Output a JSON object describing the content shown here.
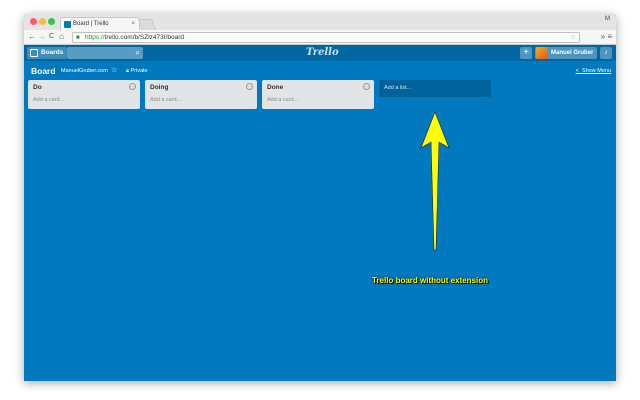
{
  "browser": {
    "tab_title": "Board | Trello",
    "tab_close": "×",
    "profile_initial": "M",
    "url_https": "https://",
    "url_rest": "trello.com/b/SZlz473I/board",
    "nav_back": "←",
    "nav_forward": "→",
    "nav_reload": "C",
    "nav_home": "⌂",
    "menu": "»  ≡"
  },
  "header": {
    "boards_label": "Boards",
    "logo_text": "Trello",
    "add_label": "+",
    "user_name": "Manuel Gruber",
    "bell": "🔔"
  },
  "board": {
    "title": "Board",
    "team": "ManuelGruber.com",
    "visibility": "Private",
    "show_menu": "Show Menu",
    "show_menu_chevron": "<"
  },
  "lists": [
    {
      "name": "Do",
      "add_card": "Add a card..."
    },
    {
      "name": "Doing",
      "add_card": "Add a card..."
    },
    {
      "name": "Done",
      "add_card": "Add a card..."
    }
  ],
  "add_list": "Add a list...",
  "annotation": {
    "caption": "Trello board without extension",
    "color": "#ffff00"
  },
  "colors": {
    "board_bg": "#0079bf",
    "header_bg": "#0067a3"
  }
}
